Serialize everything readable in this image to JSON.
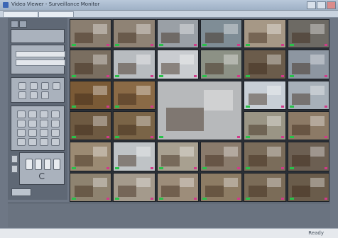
{
  "window": {
    "title": "Video Viewer - Surveillance Monitor",
    "status_text": "Ready"
  },
  "colors": {
    "title_bar": "#a9bbd0",
    "panel": "#5f6875",
    "grid_bg": "#2a2f36",
    "live_badge": "#29c24a",
    "rec_badge": "#d13a8a"
  },
  "icons": {
    "app": "app-icon",
    "minimize": "minimize-icon",
    "maximize": "maximize-icon",
    "close": "close-icon"
  },
  "cameras": [
    {
      "bg": "#8a7e70"
    },
    {
      "bg": "#8f8375"
    },
    {
      "bg": "#9aa0a6"
    },
    {
      "bg": "#7f8d96"
    },
    {
      "bg": "#a69886"
    },
    {
      "bg": "#6d6a64"
    },
    {
      "bg": "#7a6e60"
    },
    {
      "bg": "#b8bcc0"
    },
    {
      "bg": "#c9ccd0"
    },
    {
      "bg": "#8c9185"
    },
    {
      "bg": "#6b5c4b"
    },
    {
      "bg": "#8d96a1"
    },
    {
      "bg": "#7a5a36"
    },
    {
      "bg": "#8a6a46"
    },
    {
      "bg": "#b7b9bb",
      "big": true
    },
    {
      "bg": "#c8cfd6"
    },
    {
      "bg": "#a7b0b9"
    },
    {
      "bg": "#6e5a42"
    },
    {
      "bg": "#7a6447"
    },
    {
      "bg": "#9a9585"
    },
    {
      "bg": "#8c7a66"
    },
    {
      "bg": "#9b8a73"
    },
    {
      "bg": "#bfc3c6"
    },
    {
      "bg": "#a8a090"
    },
    {
      "bg": "#8a7b6c"
    },
    {
      "bg": "#7a6c5a"
    },
    {
      "bg": "#6c5f52"
    },
    {
      "bg": "#8e8370"
    },
    {
      "bg": "#a49a8c"
    },
    {
      "bg": "#9d8d7a"
    },
    {
      "bg": "#8d7c64"
    },
    {
      "bg": "#7b6c58"
    },
    {
      "bg": "#6a5c4b"
    }
  ]
}
